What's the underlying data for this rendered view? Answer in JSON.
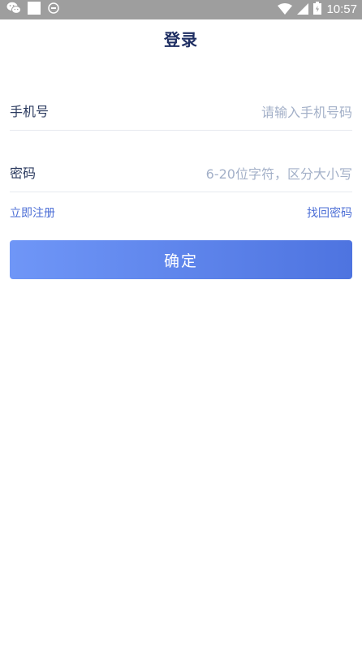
{
  "status_bar": {
    "time": "10:57",
    "icons": [
      "wechat-icon",
      "square-notification-icon",
      "sync-icon",
      "wifi-icon",
      "signal-icon",
      "battery-icon"
    ]
  },
  "header": {
    "title": "登录"
  },
  "form": {
    "phone": {
      "label": "手机号",
      "placeholder": "请输入手机号码",
      "value": ""
    },
    "password": {
      "label": "密码",
      "placeholder": "6-20位字符，区分大小写",
      "value": ""
    }
  },
  "links": {
    "register": "立即注册",
    "forgot": "找回密码"
  },
  "confirm_button": {
    "label": "确定"
  },
  "colors": {
    "status_bar": "#9e9e9e",
    "title": "#1f2f63",
    "link": "#4d6fd6",
    "button_start": "#6f96f7",
    "button_end": "#4e74e0"
  }
}
